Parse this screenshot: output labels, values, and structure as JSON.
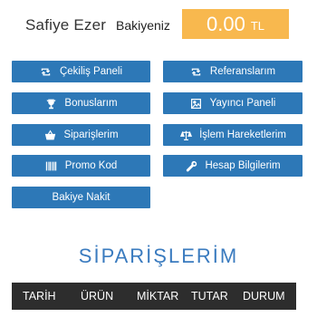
{
  "header": {
    "username": "Safiye Ezer",
    "balance_label": "Bakiyeniz",
    "balance_amount": "0.00",
    "balance_currency": "TL",
    "balance_color": "#f8b84e"
  },
  "buttons": {
    "withdraw_panel": {
      "label": "Çekiliş Paneli",
      "icon": "retweet-icon"
    },
    "referrals": {
      "label": "Referanslarım",
      "icon": "retweet-icon"
    },
    "bonuses": {
      "label": "Bonuslarım",
      "icon": "trophy-icon"
    },
    "publisher_panel": {
      "label": "Yayıncı Paneli",
      "icon": "image-icon"
    },
    "orders": {
      "label": "Siparişlerim",
      "icon": "basket-icon"
    },
    "transactions": {
      "label": "İşlem Hareketlerim",
      "icon": "balance-scale-icon"
    },
    "promo_code": {
      "label": "Promo Kod",
      "icon": "barcode-icon"
    },
    "account_info": {
      "label": "Hesap Bilgilerim",
      "icon": "wrench-icon"
    },
    "cash_balance": {
      "label": "Bakiye Nakit"
    },
    "color": "#2d78b7"
  },
  "section": {
    "title": "SİPARİŞLERİM",
    "color": "#3a7bbf"
  },
  "table": {
    "columns": [
      "TARİH",
      "ÜRÜN",
      "MİKTAR",
      "TUTAR",
      "DURUM"
    ],
    "header_bg": "#2d2d2d"
  }
}
